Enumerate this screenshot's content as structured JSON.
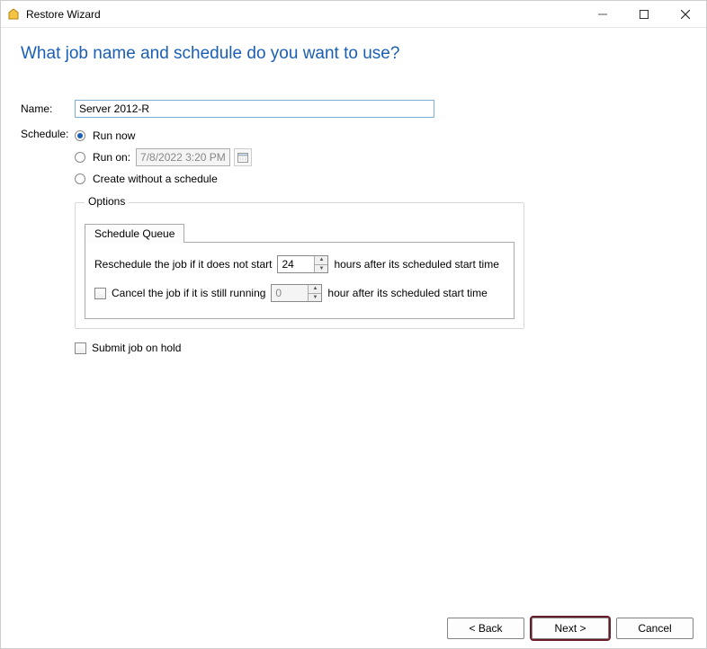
{
  "window": {
    "title": "Restore Wizard"
  },
  "page": {
    "heading": "What job name and schedule do you want to use?"
  },
  "form": {
    "name_label": "Name:",
    "name_value": "Server 2012-R",
    "schedule_label": "Schedule:",
    "radios": {
      "run_now": "Run now",
      "run_on": "Run on:",
      "create_no_schedule": "Create without a schedule"
    },
    "run_on_date": "7/8/2022 3:20 PM"
  },
  "options": {
    "legend": "Options",
    "tab_label": "Schedule Queue",
    "reschedule_prefix": "Reschedule the job if it does not start",
    "reschedule_value": "24",
    "reschedule_suffix": "hours after its scheduled start time",
    "cancel_prefix": "Cancel the job if it is still running",
    "cancel_value": "0",
    "cancel_suffix": "hour after its scheduled start time"
  },
  "submit_on_hold": "Submit job on hold",
  "buttons": {
    "back": "< Back",
    "next": "Next >",
    "cancel": "Cancel"
  }
}
